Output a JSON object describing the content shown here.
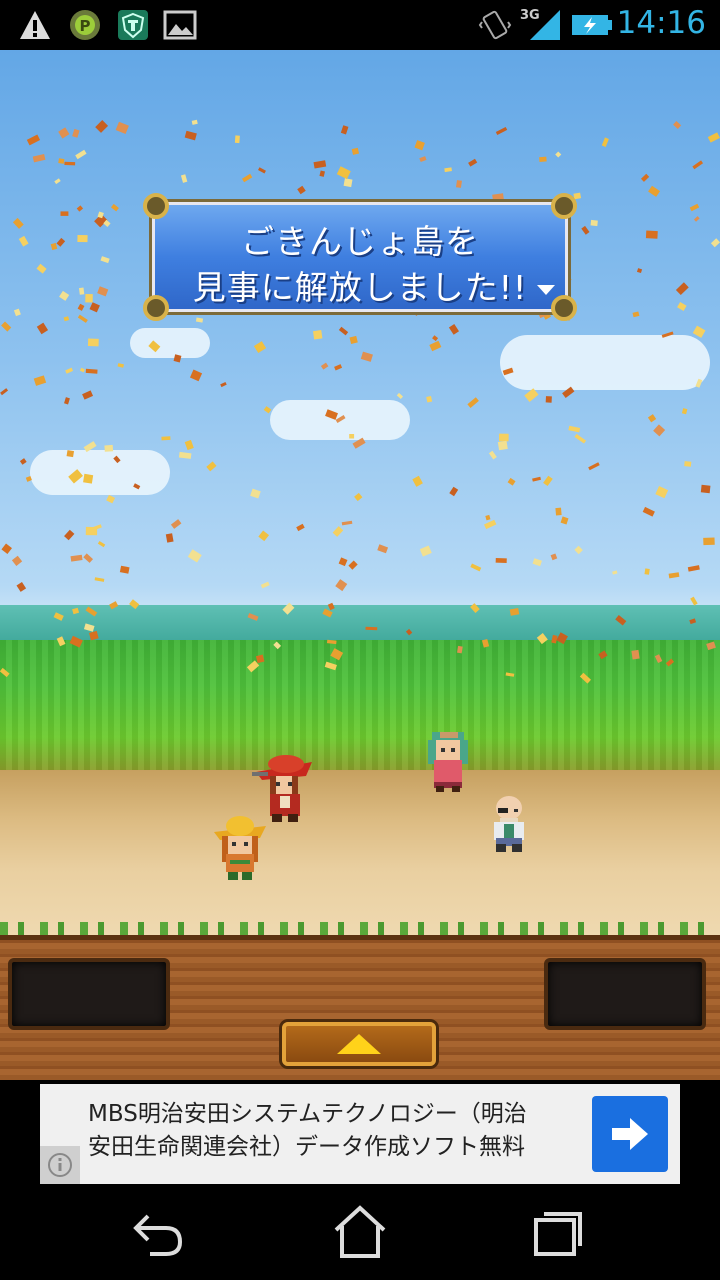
{
  "status_bar": {
    "time": "14:16",
    "network": "3G",
    "icons": [
      "warning-icon",
      "app-p-icon",
      "shield-app-icon",
      "image-icon",
      "vibrate-icon",
      "signal-icon",
      "battery-charging-icon"
    ]
  },
  "dialog": {
    "line1": "ごきんじょ島を",
    "line2": "見事に解放しました!!"
  },
  "characters": [
    "red-hat-adventurer",
    "green-haired-girl",
    "yellow-hat-girl",
    "bald-eyepatch-man"
  ],
  "ad": {
    "text_line1": "MBS明治安田システムテクノロジー（明治",
    "text_line2": "安田生命関連会社）データ作成ソフト無料",
    "info_icon": "info-icon",
    "arrow_icon": "arrow-right-icon"
  },
  "nav": {
    "back": "back-icon",
    "home": "home-icon",
    "recents": "recents-icon"
  },
  "colors": {
    "dialog_blue": "#3f7fe0",
    "status_time": "#33b5e5",
    "ad_button": "#1a6fe0"
  }
}
